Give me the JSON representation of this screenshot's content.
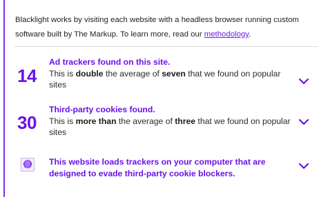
{
  "intro": {
    "text": "Blacklight works by visiting each website with a headless browser running custom software built by The Markup. To learn more, read our ",
    "link_label": "methodology",
    "suffix": "."
  },
  "findings": [
    {
      "count": "14",
      "title": "Ad trackers found on this site.",
      "desc_pre": "This is ",
      "desc_bold1": "double",
      "desc_mid": " the average of ",
      "desc_bold2": "seven",
      "desc_post": " that we found on popular sites"
    },
    {
      "count": "30",
      "title": "Third-party cookies found.",
      "desc_pre": "This is ",
      "desc_bold1": "more than",
      "desc_mid": " the average of ",
      "desc_bold2": "three",
      "desc_post": " that we found on popular sites"
    }
  ],
  "evasion": {
    "icon": "fingerprint-icon",
    "text": "This website loads trackers on your computer that are designed to evade third-party cookie blockers."
  },
  "colors": {
    "accent": "#6a12e6",
    "frame": "#7b2fe0"
  }
}
